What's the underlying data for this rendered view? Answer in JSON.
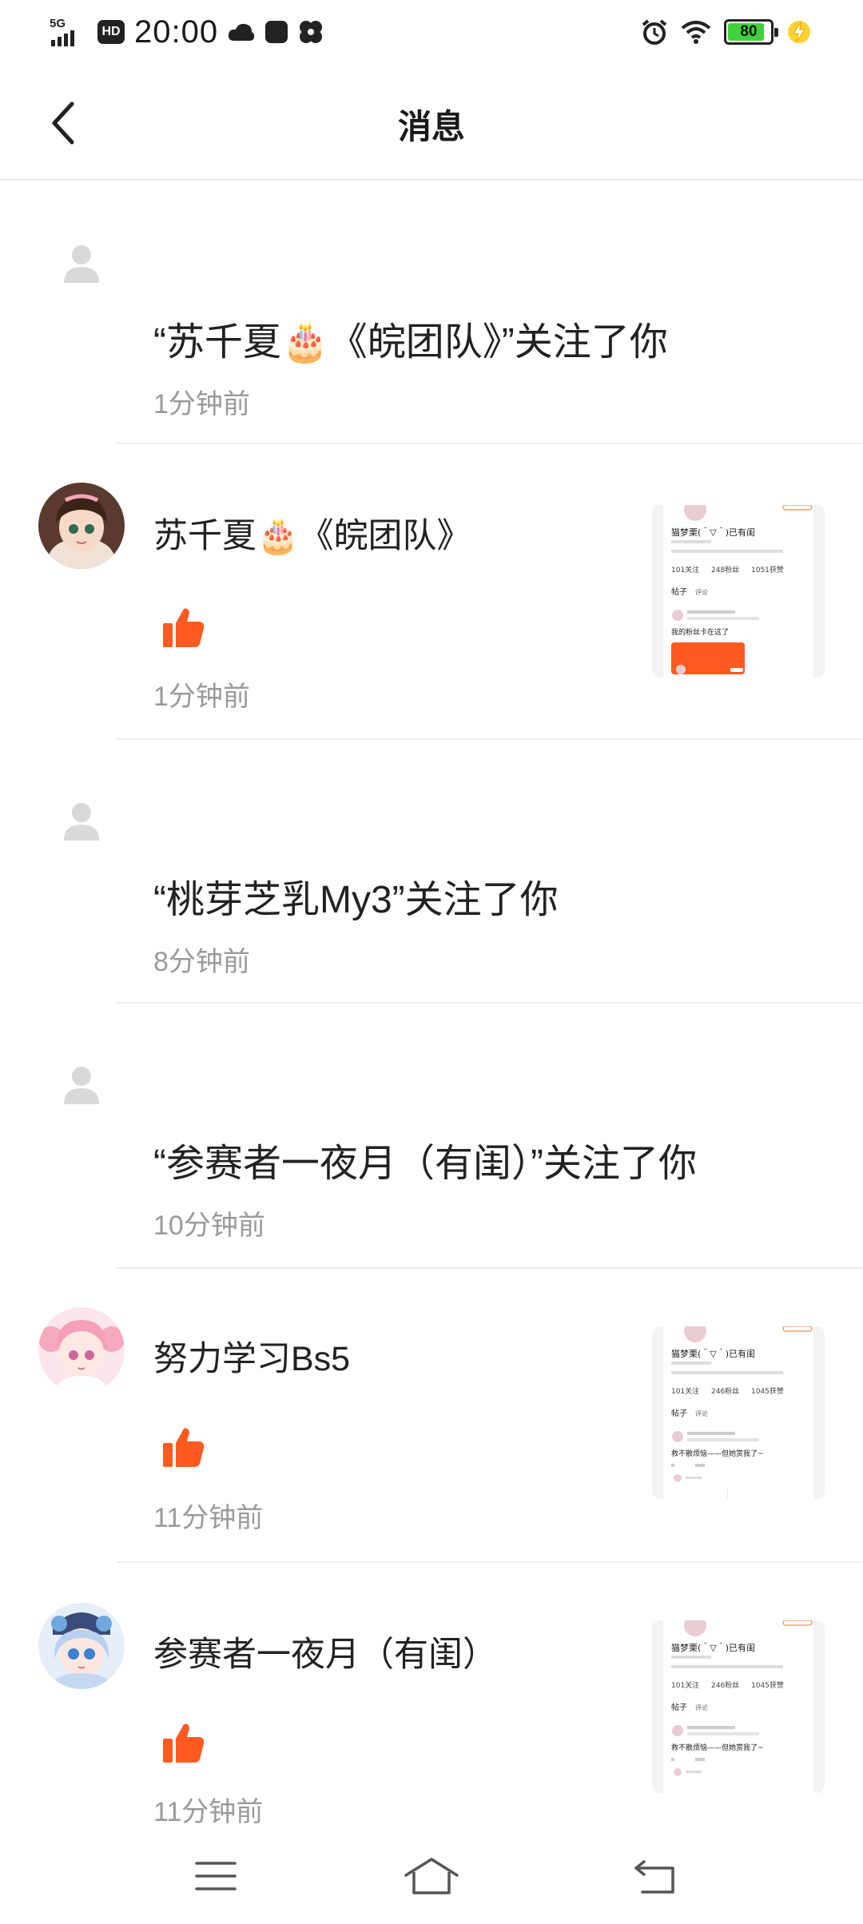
{
  "status_bar": {
    "network": "5G",
    "hd_label": "HD",
    "time": "20:00",
    "battery_percent": 80,
    "battery_label": "80",
    "icons": [
      "signal-icon",
      "hd-icon",
      "cloud-icon",
      "app-icon",
      "pinwheel-icon",
      "alarm-icon",
      "wifi-icon",
      "battery-icon",
      "charging-icon"
    ]
  },
  "header": {
    "title": "消息",
    "back_icon": "chevron-left-icon"
  },
  "messages": [
    {
      "type": "follow",
      "avatar": "placeholder",
      "text": "“苏千夏🎂《皖团队》”关注了你",
      "time": "1分钟前"
    },
    {
      "type": "like",
      "avatar": "anime-girl-brown-hair",
      "name": "苏千夏🎂《皖团队》",
      "action_icon": "thumbs-up-icon",
      "time": "1分钟前",
      "thumbnail": {
        "username": "猫梦栗(＾▽＾)已有闺",
        "stats": [
          "101关注",
          "248粉丝",
          "1051获赞"
        ],
        "tabs": [
          "帖子",
          "评论"
        ],
        "post_line": "我的粉丝卡在这了"
      }
    },
    {
      "type": "follow",
      "avatar": "placeholder",
      "text": "“桃芽芝乳My3”关注了你",
      "time": "8分钟前"
    },
    {
      "type": "follow",
      "avatar": "placeholder",
      "text": "“参赛者一夜月（有闺）”关注了你",
      "time": "10分钟前"
    },
    {
      "type": "like",
      "avatar": "anime-girl-pink-hair",
      "name": "努力学习Bs5",
      "action_icon": "thumbs-up-icon",
      "time": "11分钟前",
      "thumbnail": {
        "username": "猫梦栗(＾▽＾)已有闺",
        "stats": [
          "101关注",
          "246粉丝",
          "1045获赞"
        ],
        "tabs": [
          "帖子",
          "评论"
        ],
        "post_line": "救不散烦恼——但她赏我了~"
      }
    },
    {
      "type": "like",
      "avatar": "anime-girl-blue-hair",
      "name": "参赛者一夜月（有闺）",
      "action_icon": "thumbs-up-icon",
      "time": "11分钟前",
      "thumbnail": {
        "username": "猫梦栗(＾▽＾)已有闺",
        "stats": [
          "101关注",
          "246粉丝",
          "1045获赞"
        ],
        "tabs": [
          "帖子",
          "评论"
        ],
        "post_line": "救不散烦恼——但她赏我了~"
      }
    }
  ],
  "nav_bar": {
    "items": [
      "menu-icon",
      "home-icon",
      "back-icon"
    ]
  },
  "colors": {
    "accent": "#ff5a1f",
    "divider": "#eeeeee",
    "time_text": "#9a9a9a"
  }
}
